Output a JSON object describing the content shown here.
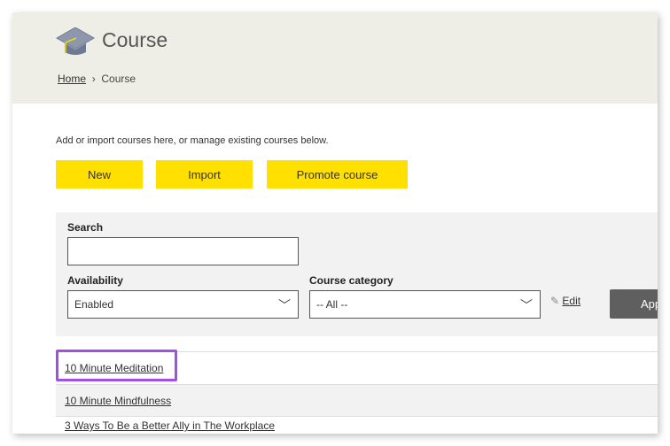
{
  "header": {
    "title": "Course",
    "breadcrumb": {
      "home": "Home",
      "current": "Course"
    }
  },
  "intro": "Add or import courses here, or manage existing courses below.",
  "buttons": {
    "new": "New",
    "import": "Import",
    "promote": "Promote course"
  },
  "filters": {
    "search_label": "Search",
    "search_value": "",
    "availability_label": "Availability",
    "availability_value": "Enabled",
    "category_label": "Course category",
    "category_value": "-- All --",
    "edit_label": "Edit",
    "apply_label": "Apply"
  },
  "courses": [
    "10 Minute Meditation",
    "10 Minute Mindfulness",
    "3 Ways To Be a Better Ally in The Workplace"
  ],
  "colors": {
    "accent": "#ffe000",
    "highlight": "#a34ee6"
  }
}
